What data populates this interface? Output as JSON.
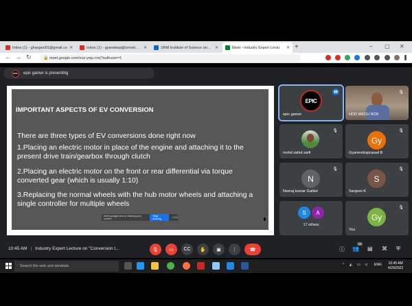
{
  "browser": {
    "tabs": [
      {
        "title": "Inbox (1) - ghargaxi01@gmail.co",
        "favicon_color": "#d93025"
      },
      {
        "title": "Inbox (1) - gyandeep@srmist.edu",
        "favicon_color": "#d93025"
      },
      {
        "title": "SRM Institute of Science and Tec",
        "favicon_color": "#1565c0"
      },
      {
        "title": "Meet - Industry Expert Lectu",
        "favicon_color": "#00832d"
      }
    ],
    "url": "meet.google.com/xoz-yeju-cmj?authuser=1",
    "nav_icons": [
      "back-icon",
      "forward-icon",
      "reload-icon"
    ]
  },
  "meet": {
    "presenting_text": "epic gamer is presenting",
    "presenter_avatar_text": "EPIC",
    "slide": {
      "title": "IMPORTANT ASPECTS OF EV CONVERSION",
      "intro": "There are three types of EV conversions done right now",
      "points": [
        {
          "num": "1.",
          "text": "Placing an electric motor in place of the engine and attaching it to the present drive train/gearbox through clutch"
        },
        {
          "num": "2.",
          "text": "Placing an electric motor on the front or rear differential via torque converted gear (which is usually 1:10)"
        },
        {
          "num": "3.",
          "text": "Replacing the normal wheels with the hub motor wheels and attaching a single controller for multiple wheels"
        }
      ],
      "share_bar": {
        "text": "meet.google.com is sharing your screen.",
        "stop": "Stop sharing",
        "hide": "Hide"
      }
    },
    "participants": [
      {
        "name": "epic gamer",
        "type": "logo",
        "logo_text": "EPIC"
      },
      {
        "name": "HOD MECH NCR",
        "type": "photo"
      },
      {
        "name": "mohd zahid sarfi",
        "type": "photo-avatar"
      },
      {
        "name": "Gyanendraprasad B",
        "initials": "Gy",
        "color": "#e8710a"
      },
      {
        "name": "Neeraj kumar Gahlot",
        "initials": "N",
        "color": "#5f6368"
      },
      {
        "name": "Sanjeev K",
        "initials": "S",
        "color": "#795548"
      },
      {
        "name": "17 others",
        "type": "group",
        "initials": [
          "S",
          "A"
        ],
        "colors": [
          "#1e88e5",
          "#8e24aa"
        ]
      },
      {
        "name": "You",
        "initials": "Gy",
        "color": "#7cb342"
      }
    ],
    "bottom": {
      "time": "10:45 AM",
      "meeting_title": "Industry Expert Lecture on \"Conversion t...",
      "participant_count": "25"
    }
  },
  "taskbar": {
    "search_placeholder": "Search the web and windows",
    "lang": "ENG",
    "time": "10:45 AM",
    "date": "4/29/2022"
  }
}
